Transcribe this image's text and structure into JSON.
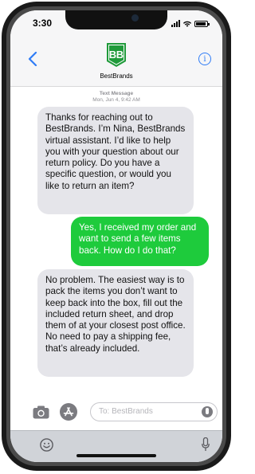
{
  "status_bar": {
    "time": "3:30"
  },
  "header": {
    "contact_name": "BestBrands",
    "logo_icon": "bestbrands-logo",
    "back_icon": "chevron-left-icon",
    "info_icon": "info-icon",
    "info_glyph": "i",
    "accent_color": "#2f7cf6",
    "brand_color": "#1f9a3a"
  },
  "conversation": {
    "meta_title": "Text Message",
    "meta_timestamp": "Mon, Jun 4, 9:42 AM",
    "messages": [
      {
        "direction": "incoming",
        "text": "Thanks for reaching  out to BestBrands. I’m Nina, BestBrands virtual assistant. I’d like to help you with your question about our return policy. Do you have a specific question, or would you like to return an item?"
      },
      {
        "direction": "outgoing",
        "text": "Yes, I received my order and want to send a few items back. How do I do that?"
      },
      {
        "direction": "incoming",
        "text": "No problem.  The easiest way is to pack the items you don’t want to keep back into the box, fill out the included return sheet, and drop them of at your closest post office. No need to pay a shipping fee, that’s already included."
      }
    ],
    "incoming_color": "#e5e5ea",
    "outgoing_color": "#1ecb3c"
  },
  "composer": {
    "placeholder": "To: BestBrands",
    "camera_icon": "camera-icon",
    "apps_icon": "app-store-icon",
    "audio_icon": "audio-record-icon"
  },
  "keyboard_bar": {
    "emoji_icon": "emoji-icon",
    "mic_icon": "microphone-icon"
  }
}
